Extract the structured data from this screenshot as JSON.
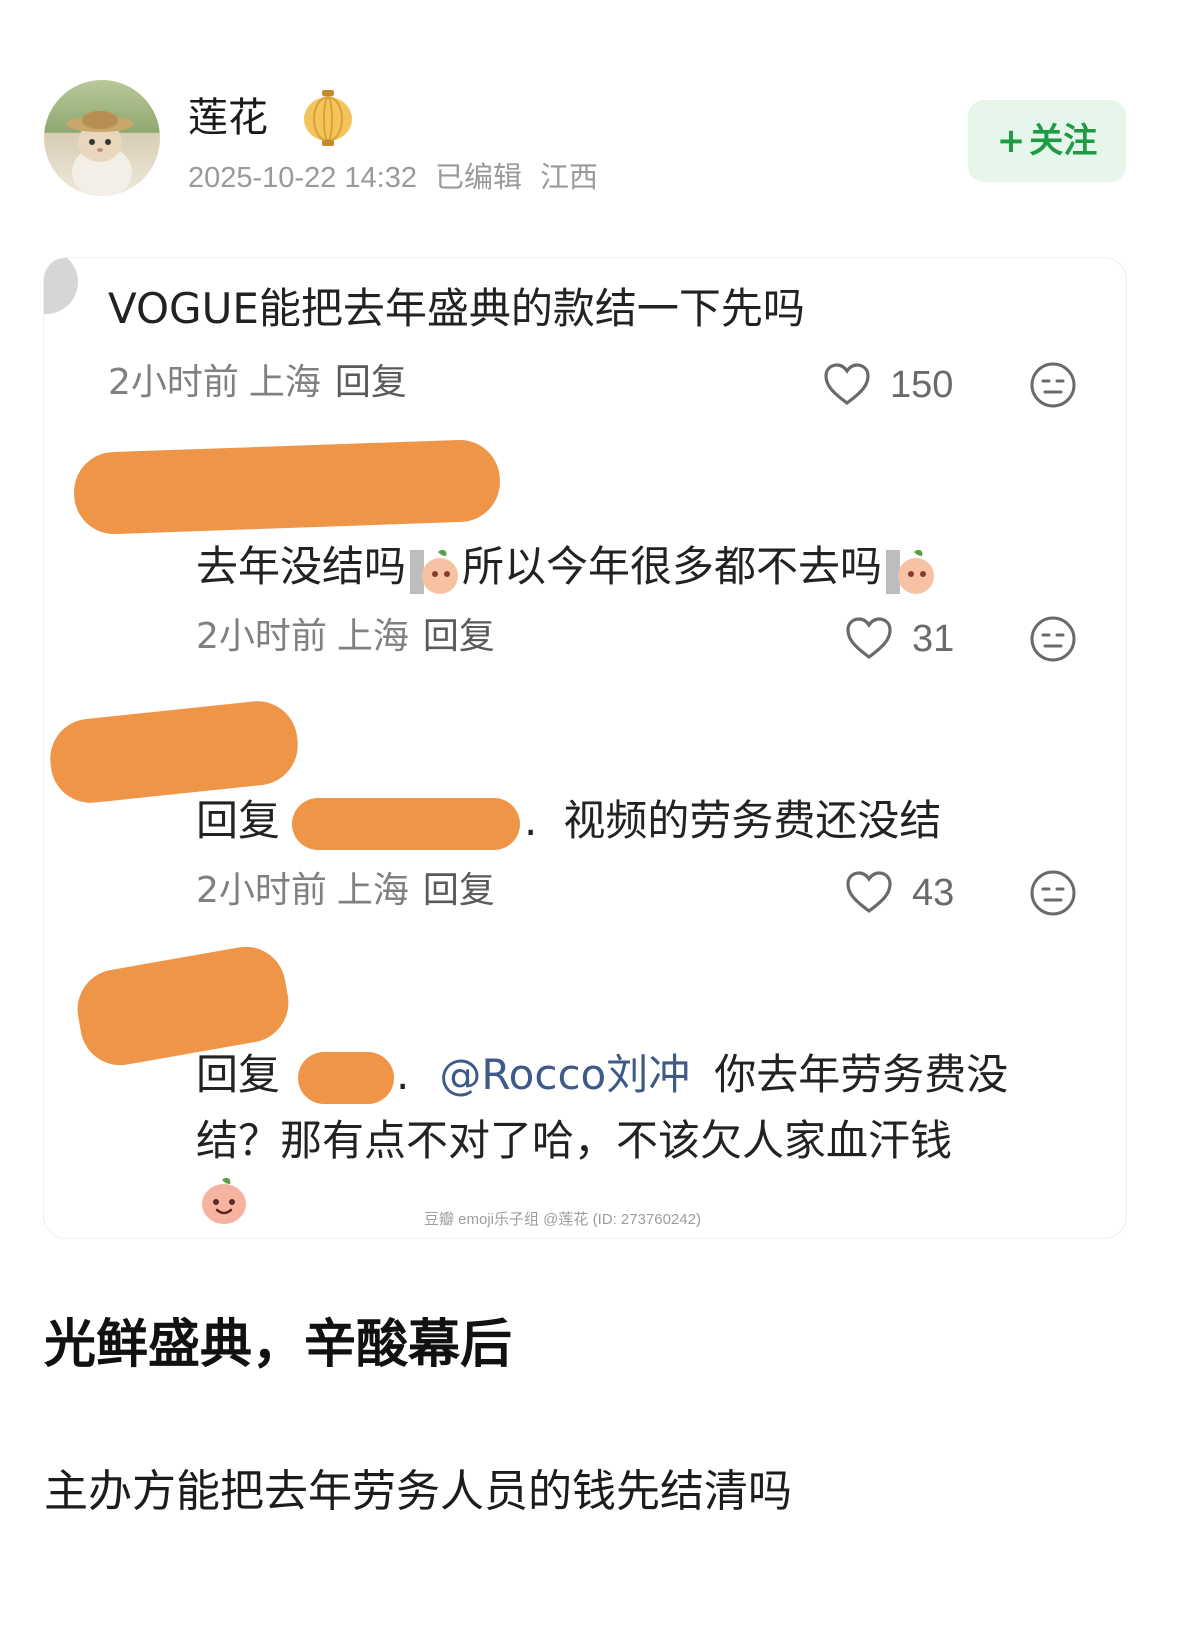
{
  "author": {
    "name": "莲花",
    "badge_icon": "lantern-icon",
    "avatar_icon": "cat-avatar"
  },
  "post_meta": {
    "date": "2025-10-22 14:32",
    "edited": "已编辑",
    "location": "江西"
  },
  "follow_button": {
    "plus": "+",
    "label": "关注"
  },
  "comments": [
    {
      "text": "VOGUE能把去年盛典的款结一下先吗",
      "time": "2小时前",
      "location": "上海",
      "reply_label": "回复",
      "likes": "150"
    },
    {
      "text_part1": "去年没结吗",
      "text_part2": "所以今年很多都不去吗",
      "time": "2小时前",
      "location": "上海",
      "reply_label": "回复",
      "likes": "31"
    },
    {
      "reply_prefix": "回复",
      "dot": ".",
      "text": "视频的劳务费还没结",
      "time": "2小时前",
      "location": "上海",
      "reply_label": "回复",
      "likes": "43"
    },
    {
      "reply_prefix": "回复",
      "dot": ".",
      "mention": "@Rocco刘冲",
      "text_line1": "你去年劳务费没",
      "text_line2": "结？那有点不对了哈，不该欠人家血汗钱"
    }
  ],
  "watermark": "豆瓣  emoji乐子组 @莲花 (ID: 273760242)",
  "post": {
    "title": "光鲜盛典，辛酸幕后",
    "body": "主办方能把去年劳务人员的钱先结清吗"
  },
  "colors": {
    "follow_bg": "#e6f6ea",
    "follow_text": "#1f9b43",
    "redaction": "#ee9548",
    "mention": "#3d5a8a"
  }
}
